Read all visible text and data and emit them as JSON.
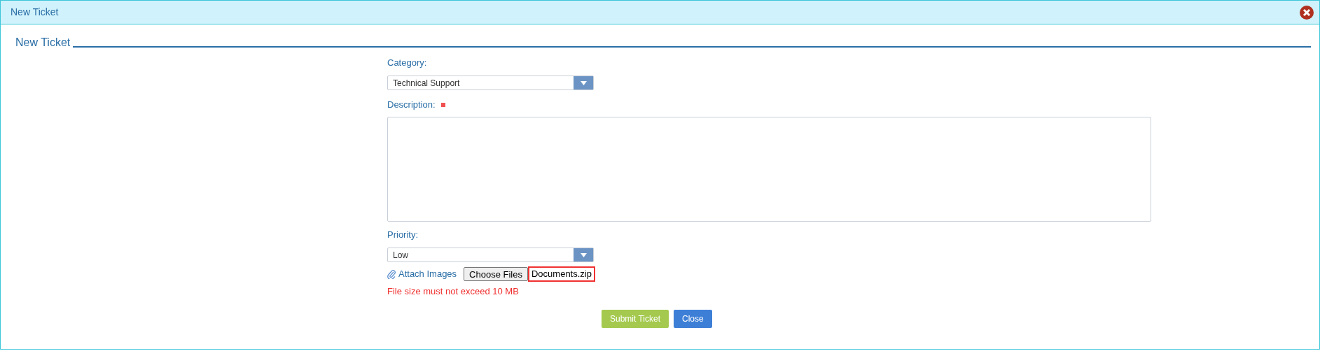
{
  "window": {
    "title": "New Ticket"
  },
  "section": {
    "title": "New Ticket"
  },
  "fields": [
    {
      "kind": "select",
      "label": "Category:",
      "value": "Technical Support",
      "required": false
    },
    {
      "kind": "textarea",
      "label": "Description:",
      "required": true
    },
    {
      "kind": "select",
      "label": "Priority:",
      "value": "Low",
      "required": false
    }
  ],
  "attachment": {
    "label": "Attach Images",
    "button": "Choose Files",
    "file": "Documents.zip",
    "highlighted": true,
    "error": "File size must not exceed 10 MB"
  },
  "buttons": [
    {
      "label": "Submit Ticket",
      "kind": "primary"
    },
    {
      "label": "Close",
      "kind": "secondary"
    }
  ]
}
